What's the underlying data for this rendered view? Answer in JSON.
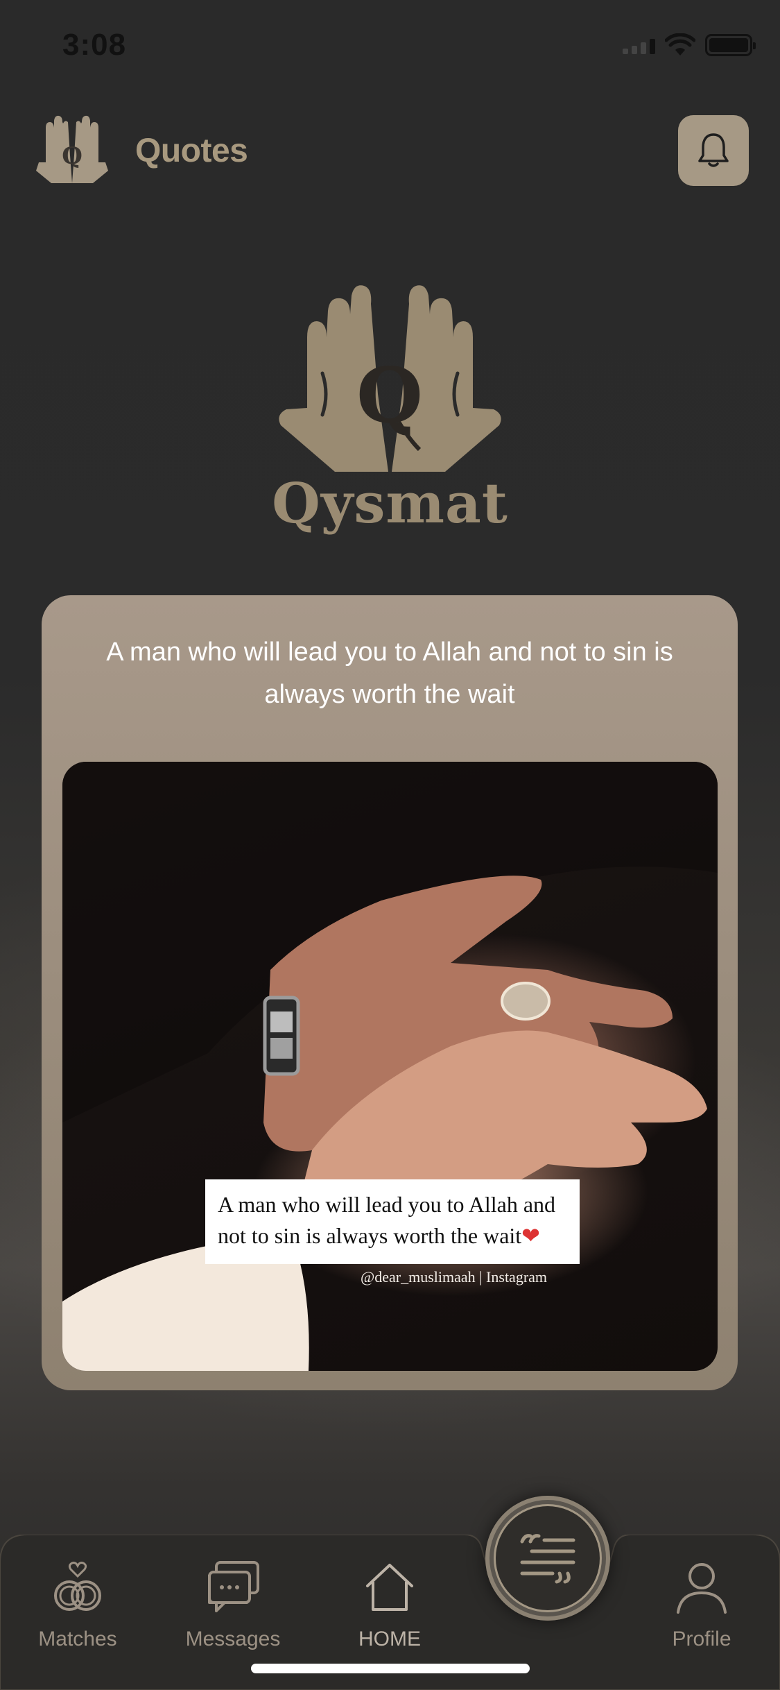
{
  "status_bar": {
    "time": "3:08",
    "icons": [
      "cellular-signal-icon",
      "wifi-icon",
      "battery-icon"
    ]
  },
  "header": {
    "title": "Quotes",
    "logo_icon": "praying-hands-logo-icon",
    "notification_icon": "bell-icon"
  },
  "brand": {
    "name": "Qysmat",
    "logo_icon": "praying-hands-logo-icon"
  },
  "quote_card": {
    "text": "A man who will lead you to Allah and not to sin is always worth the wait",
    "image": {
      "caption_line1": "A man who will lead you to Allah and",
      "caption_line2": "not to sin is always worth the wait",
      "caption_emoji": "❤",
      "credit": "@dear_muslimaah | Instagram"
    }
  },
  "bottom_nav": {
    "items": [
      {
        "label": "Matches",
        "icon": "rings-heart-icon"
      },
      {
        "label": "Messages",
        "icon": "chat-bubbles-icon"
      },
      {
        "label": "HOME",
        "icon": "home-icon"
      },
      {
        "label": "Profile",
        "icon": "person-icon"
      }
    ],
    "center_button_icon": "quote-icon"
  },
  "colors": {
    "accent": "#a69985",
    "brand_text": "#9a8b72",
    "background": "#2a2a2a",
    "nav_label": "#9c9184"
  }
}
